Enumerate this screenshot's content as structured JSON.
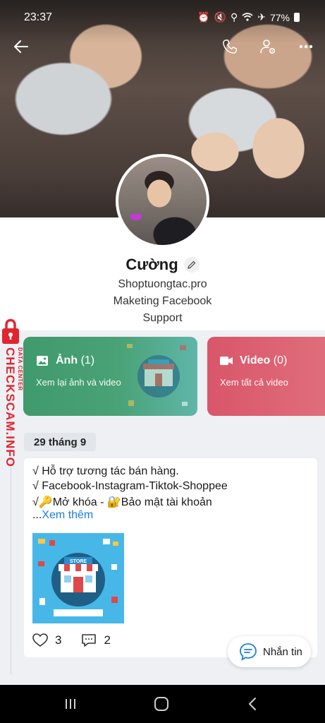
{
  "status_bar": {
    "time": "23:37",
    "battery": "77%"
  },
  "profile": {
    "name": "Cường",
    "bio_lines": [
      "Shoptuongtac.pro",
      "Maketing Facebook",
      "Support"
    ]
  },
  "media": {
    "photos": {
      "label": "Ảnh",
      "count": "(1)",
      "subtitle": "Xem lại ảnh và video"
    },
    "video": {
      "label": "Video",
      "count": "(0)",
      "subtitle": "Xem tất cả video"
    }
  },
  "timeline": {
    "date": "29 tháng 9",
    "post": {
      "lines": [
        "√ Hỗ trợ tương tác bán hàng.",
        "√ Facebook-Instagram-Tiktok-Shoppee",
        "√🔑Mở khóa - 🔐Bảo mật tài khoản"
      ],
      "see_more_prefix": "...",
      "see_more_link": "Xem thêm",
      "image_label": "STORE",
      "likes": "3",
      "comments": "2"
    }
  },
  "chat_button": {
    "label": "Nhắn tin"
  },
  "watermark": {
    "title": "CHECKSCAM.INFO",
    "subtitle": "DATA CENTER"
  },
  "colors": {
    "photos_card": "#3f9a6c",
    "video_card": "#d9566a",
    "link": "#1a7fe0",
    "watermark": "#e0252f"
  }
}
